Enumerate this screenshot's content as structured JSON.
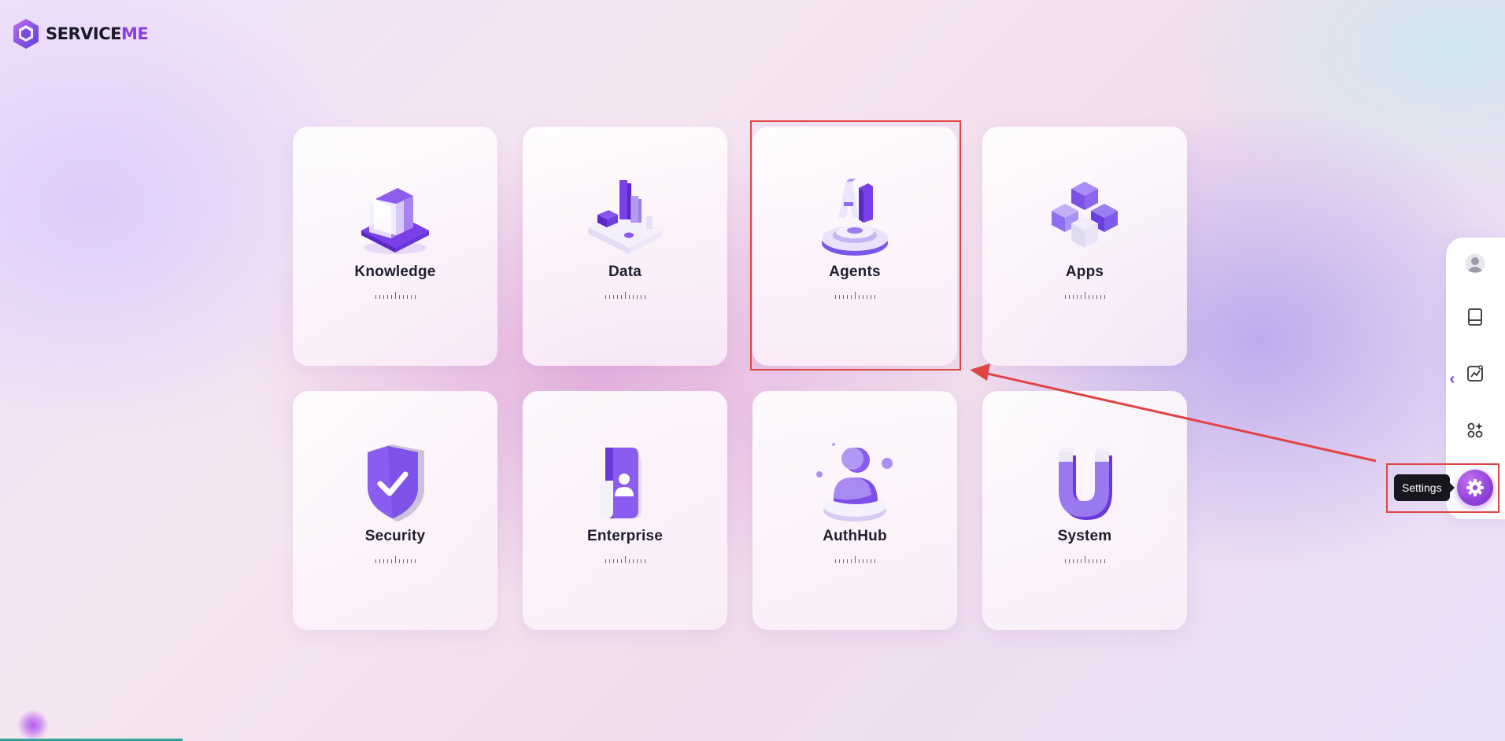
{
  "app": {
    "logo_text_main": "SERVICE",
    "logo_text_accent": "ME",
    "logo_icon": "cube-logo-icon"
  },
  "modules": [
    {
      "label": "Knowledge",
      "icon": "books-icon"
    },
    {
      "label": "Data",
      "icon": "bar-chart-platform-icon"
    },
    {
      "label": "Agents",
      "icon": "ai-pedestal-icon"
    },
    {
      "label": "Apps",
      "icon": "cubes-icon"
    },
    {
      "label": "Security",
      "icon": "shield-check-icon"
    },
    {
      "label": "Enterprise",
      "icon": "id-card-icon"
    },
    {
      "label": "AuthHub",
      "icon": "user-pedestal-icon"
    },
    {
      "label": "System",
      "icon": "magnet-icon"
    }
  ],
  "sidebar": {
    "items": [
      {
        "name": "user-avatar",
        "icon": "avatar-icon"
      },
      {
        "name": "knowledge",
        "icon": "book-icon"
      },
      {
        "name": "analytics",
        "icon": "trend-chart-icon"
      },
      {
        "name": "apps",
        "icon": "apps-grid-icon"
      }
    ],
    "collapse_icon": "chevron-left-icon",
    "settings_tooltip": "Settings",
    "settings_icon": "gear-icon"
  },
  "colors": {
    "accent": "#8a3ad8",
    "annotation": "#e04545"
  }
}
